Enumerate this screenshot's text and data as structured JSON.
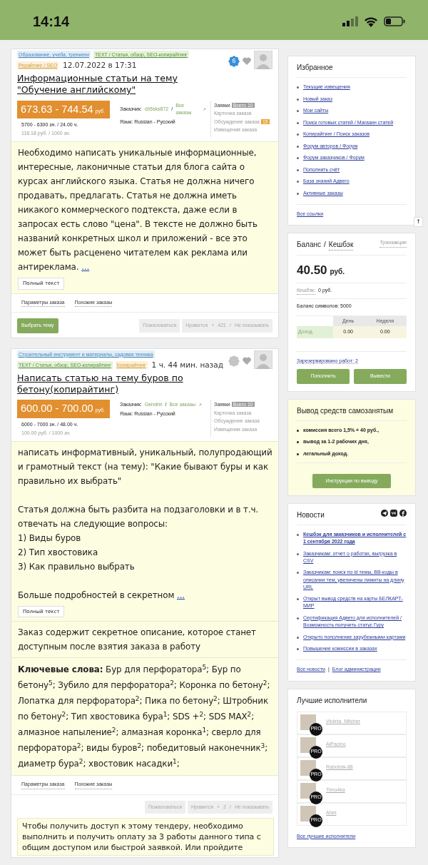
{
  "status_bar": {
    "time": "14:14"
  },
  "orders": [
    {
      "tags": [
        {
          "text": "Образование, учеба, тренинги",
          "kind": "topic"
        },
        {
          "text": "TEXT / Статья, обзор, SEO-копирайтинг",
          "kind": "type"
        },
        {
          "text": "Рерайтинг / SEO",
          "kind": "mode"
        }
      ],
      "time": "12.07.2022 в 17:31",
      "seal_active": true,
      "seal_text": "6",
      "title": "Информационные статьи на тему \"Обучение английскому\"",
      "price": "673.63 - 744.54",
      "currency": "руб.",
      "volume": "5700 - 6300 зн. / 24.00 ч.",
      "rate": "118.18 руб. / 1000 зн.",
      "customer_label": "Заказчик:",
      "customer": "cb5sks872",
      "sep": "/",
      "all_orders": "Все заказы",
      "language": "Язык: Russian - Русский",
      "links": [
        {
          "text": "Заявки",
          "badge": "Всего 10",
          "kind": "count"
        },
        {
          "text": "Карточка заказа"
        },
        {
          "text": "Обсуждение заказа",
          "badge": "15",
          "kind": "new"
        },
        {
          "text": "Извещения заказа"
        }
      ],
      "description": [
        "Необходимо написать уникальные информационные, интересные, лаконичные статьи для блога сайта о курсах английского языка. Статья не должна ничего продавать, предлагать. Статья не должна иметь никакого коммерческого подтекста, даже если в запросах есть слово \"цена\". В тексте не должно быть названий конкретных школ и приложений - все это может быть расценено читателем как реклама или антиреклама."
      ],
      "more": "...",
      "full_text": "Полный текст",
      "tabs": [
        "Параметры заказа",
        "Похожие заказы"
      ],
      "choose": "Выбрать тему",
      "complain": "Пожаловаться",
      "like": "Нравится",
      "plus": "+",
      "likes": "421",
      "like_sep": "/",
      "hide": "Не показывать"
    },
    {
      "tags": [
        {
          "text": "Строительный инструмент и материалы, садовая техника",
          "kind": "topic"
        },
        {
          "text": "TEXT / Статья, обзор, SEO-копирайтинг",
          "kind": "type"
        },
        {
          "text": "Копирайтинг",
          "kind": "mode"
        }
      ],
      "time": "1 ч. 44 мин. назад",
      "seal_active": false,
      "title": "Написать статью на тему буров по бетону(копирайтинг)",
      "price": "600.00 - 700.00",
      "currency": "руб.",
      "volume": "6000 - 7000 зн. / 48.00 ч.",
      "rate": "100.00 руб. / 1000 зн.",
      "customer_label": "Заказчик:",
      "customer": "Gendrin",
      "sep": "/",
      "all_orders": "Все заказы",
      "language": "Язык: Russian - Русский",
      "links": [
        {
          "text": "Заявки",
          "badge": "Всего 10",
          "kind": "count"
        },
        {
          "text": "Карточка заказа"
        },
        {
          "text": "Обсуждение заказа"
        },
        {
          "text": "Извещения заказа"
        }
      ],
      "description": [
        "написать информативный, уникальный, полупродающий и грамотный текст (на тему): \"Какие бывают буры и как правильно их выбрать\"",
        "Статья должна быть разбита на подзаголовки и в т.ч. отвечать на следующие вопросы:\n1) Виды буров\n2) Тип хвостовика\n3) Как правильно выбрать",
        "Больше подробностей в секретном"
      ],
      "more": "...",
      "full_text": "Полный текст",
      "secret_note": "Заказ содержит секретное описание, которое станет доступным после взятия заказа в работу",
      "keywords": "**Ключевые слова:** Бур для перфоратора$^{5}$; Бур по бетону$^{5}$; Зубило для перфоратора$^{2}$; Коронка по бетону$^{2}$; Лопатка для перфоратора$^{2}$; Пика по бетону$^{2}$; Штробник по бетону$^{2}$; Тип хвостовика бура$^{1}$; SDS +$^{2}$; SDS MAX$^{2}$; алмазное напыление$^{2}$; алмазная коронка$^{1}$; сверло для перфоратора$^{2}$; виды буров$^{2}$; победитовый наконечник$^{3}$; диаметр бура$^{2}$; хвостовик насадки$^{1}$;",
      "tabs": [
        "Параметры заказа",
        "Похожие заказы"
      ],
      "complain": "Пожаловаться",
      "like": "Нравится",
      "plus": "+",
      "likes": "2",
      "like_sep": "/",
      "hide": "Не показывать",
      "access_note": "Чтобы получить доступ к этому тендеру, необходимо выполнить и получить оплату за 3 работы данного типа с общим доступом или быстрой заявкой. Или пройдите"
    }
  ],
  "scroll_top": "↑",
  "favorites": {
    "title": "Избранное",
    "items": [
      "Текущие извещения",
      "Новый заказ",
      "Мои сайты",
      "Поиск готовых статей / Магазин статей",
      "Копирайтинг / Поиск заказов",
      "Форум авторов / Форум",
      "Форум заказчиков / Форум",
      "Пополнить счёт",
      "База знаний Адвего",
      "Активные заказы"
    ],
    "footer": "Все ссылки"
  },
  "balance": {
    "title": "Баланс",
    "title_sep": "/",
    "cashback_title": "Кешбэк",
    "transactions": "Транзакции",
    "amount": "40.50",
    "currency": "руб.",
    "cashback_label": "Кешбэк:",
    "cashback": "0 руб.",
    "symbols": "Баланс символов: 5000",
    "table": {
      "columns": [
        "День",
        "Неделя"
      ],
      "rows": [
        {
          "label": "Доход",
          "values": [
            "0.00",
            "0.00"
          ]
        }
      ]
    },
    "reserved": "Зарезервировано работ: 2",
    "buttons": [
      "Пополнить",
      "Вывести"
    ]
  },
  "self_employed": {
    "title": "Вывод средств самозанятым",
    "items": [
      "комиссия всего 1,5% + 40 руб.,",
      "вывод за 1-2 рабочих дня,",
      "легальный доход."
    ],
    "button": "Инструкции по выводу"
  },
  "news": {
    "title": "Новости",
    "items": [
      {
        "text": "Кешбэк для заказчиков и исполнителей с 1 сентября 2022 года",
        "highlighted": true
      },
      {
        "text": "Заказчикам: отчет о работах, выгрузка в CSV",
        "highlighted": false
      },
      {
        "text": "Заказчикам: поиск по id темы, BB-коды в описании тем, увеличены лимиты на длину URL",
        "highlighted": false
      },
      {
        "text": "Открыт вывод средств на карты БЕЛКАРТ-МИР",
        "highlighted": false
      },
      {
        "text": "Сертификация Адвего для исполнителей / Возможность получить статус Гуру",
        "highlighted": false
      },
      {
        "text": "Открыто пополнение зарубежными картами",
        "highlighted": false
      },
      {
        "text": "Повышение комиссии в заказах",
        "highlighted": false
      }
    ],
    "footer": [
      "Все новости",
      "Блог администрации"
    ],
    "footer_sep": "|"
  },
  "best": {
    "title": "Лучшие исполнители",
    "people": [
      {
        "name": "Violeta_Mitcher",
        "badge": "PRO"
      },
      {
        "name": "AlPacino",
        "badge": "PRO"
      },
      {
        "name": "Rabotnik-88",
        "badge": "PRO"
      },
      {
        "name": "Timo4ka",
        "badge": "PRO"
      },
      {
        "name": "Ahet",
        "badge": "PRO"
      }
    ],
    "footer": "Все лучшие исполнители"
  }
}
